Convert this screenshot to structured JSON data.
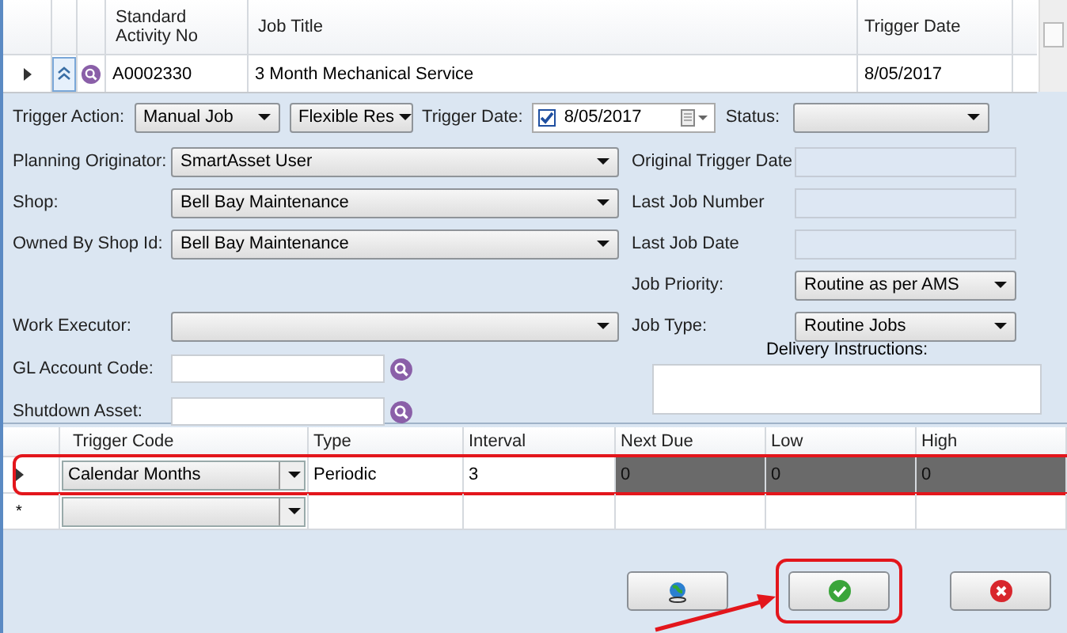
{
  "top_grid": {
    "columns": [
      "Standard Activity No",
      "Job Title",
      "Trigger Date"
    ],
    "rows": [
      {
        "expanded": true,
        "cells": [
          "A0002330",
          "3 Month Mechanical Service",
          "8/05/2017"
        ]
      }
    ]
  },
  "detail": {
    "trigger_action": {
      "label": "Trigger Action:",
      "value": "Manual Job"
    },
    "trigger_mode": {
      "value": "Flexible Res"
    },
    "trigger_date": {
      "label": "Trigger Date:",
      "checked": true,
      "value": "8/05/2017"
    },
    "status": {
      "label": "Status:"
    },
    "rows": [
      {
        "left": {
          "label": "Planning Originator:",
          "kind": "dropdown",
          "value": "SmartAsset User"
        },
        "right": {
          "label": "Original Trigger Date",
          "kind": "readonly"
        }
      },
      {
        "left": {
          "label": "Shop:",
          "kind": "dropdown",
          "value": "Bell Bay Maintenance"
        },
        "right": {
          "label": "Last Job Number",
          "kind": "readonly"
        }
      },
      {
        "left": {
          "label": "Owned By Shop Id:",
          "kind": "dropdown",
          "value": "Bell Bay Maintenance"
        },
        "right": {
          "label": "Last Job Date",
          "kind": "readonly"
        }
      },
      {
        "right": {
          "label": "Job Priority:",
          "kind": "dropdown",
          "value": "Routine as per AMS"
        }
      },
      {
        "left": {
          "label": "Work Executor:",
          "kind": "dropdown"
        },
        "right": {
          "label": "Job Type:",
          "kind": "dropdown",
          "value": "Routine Jobs"
        }
      },
      {
        "left": {
          "label": "GL Account Code:",
          "kind": "lookup"
        }
      },
      {
        "left": {
          "label": "Shutdown Asset:",
          "kind": "lookup"
        }
      }
    ],
    "delivery": {
      "label": "Delivery Instructions:"
    }
  },
  "trigger_grid": {
    "columns": [
      "Trigger Code",
      "Type",
      "Interval",
      "Next Due",
      "Low",
      "High"
    ],
    "rows": [
      {
        "highlighted": true,
        "cells": [
          {
            "text": "Calendar Months",
            "kind": "dropdown",
            "disabled": false
          },
          {
            "text": "Periodic",
            "kind": "text",
            "disabled": false
          },
          {
            "text": "3",
            "kind": "text",
            "disabled": false
          },
          {
            "text": "0",
            "kind": "text",
            "disabled": true
          },
          {
            "text": "0",
            "kind": "text",
            "disabled": true
          },
          {
            "text": "0",
            "kind": "text",
            "disabled": true
          }
        ]
      }
    ],
    "new_row_marker": "*"
  },
  "buttons": [
    {
      "kind": "globe",
      "highlighted": false
    },
    {
      "kind": "ok",
      "highlighted": true
    },
    {
      "kind": "cancel",
      "highlighted": false
    }
  ]
}
